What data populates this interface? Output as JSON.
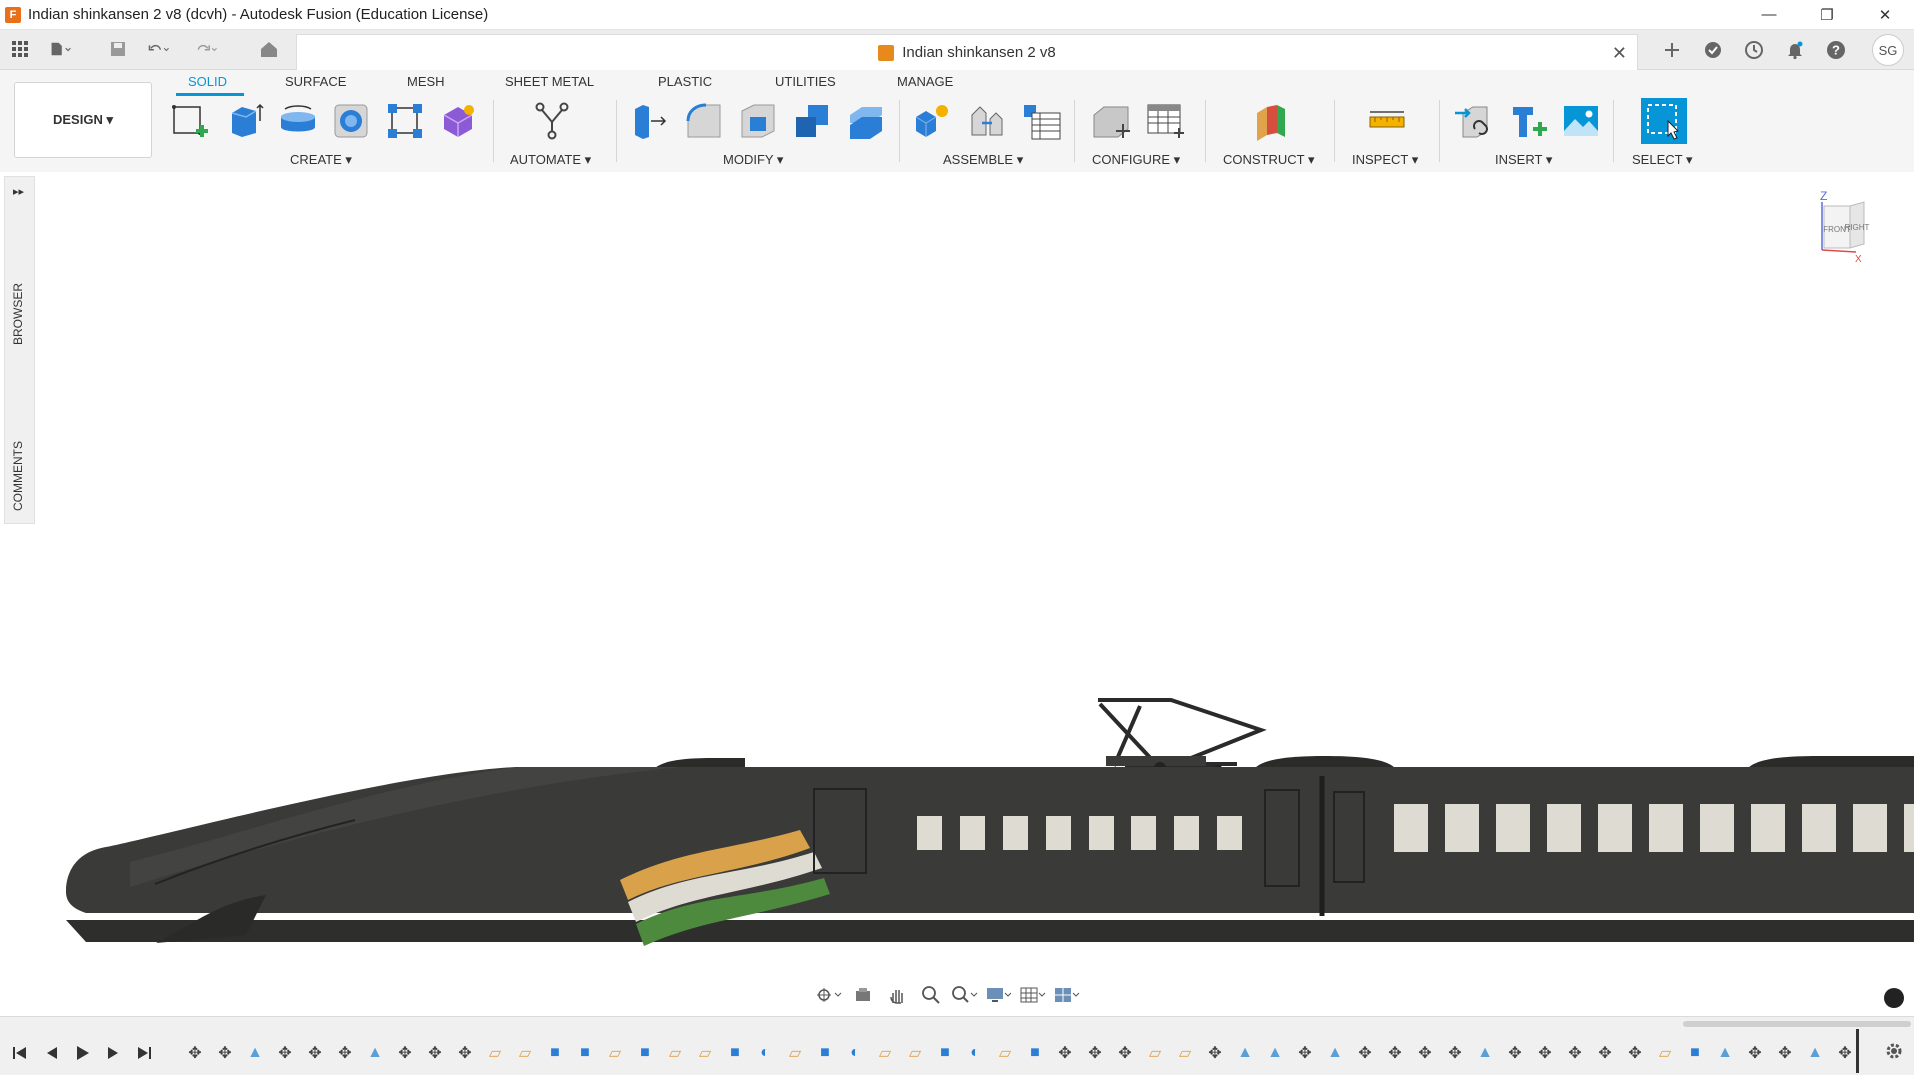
{
  "window": {
    "title": "Indian shinkansen 2 v8 (dcvh) - Autodesk Fusion (Education License)",
    "app_icon": "F",
    "controls": [
      "—",
      "❐",
      "✕"
    ]
  },
  "doc_tab": {
    "name": "Indian shinkansen 2 v8",
    "close": "✕"
  },
  "user": {
    "initials": "SG"
  },
  "workspace": {
    "label": "DESIGN ▾"
  },
  "tabs": [
    "SOLID",
    "SURFACE",
    "MESH",
    "SHEET METAL",
    "PLASTIC",
    "UTILITIES",
    "MANAGE"
  ],
  "groups": {
    "create": "CREATE ▾",
    "automate": "AUTOMATE ▾",
    "modify": "MODIFY ▾",
    "assemble": "ASSEMBLE ▾",
    "configure": "CONFIGURE ▾",
    "construct": "CONSTRUCT ▾",
    "inspect": "INSPECT ▾",
    "insert": "INSERT ▾",
    "select": "SELECT ▾"
  },
  "side": {
    "browser": "BROWSER",
    "comments": "COMMENTS",
    "expand": "▸▸"
  },
  "viewcube": {
    "front": "FRONT",
    "right": "RIGHT",
    "z": "Z",
    "x": "X"
  },
  "timeline": {
    "items": [
      "move",
      "move",
      "mirror",
      "move",
      "move",
      "move",
      "mirror",
      "move",
      "move",
      "move",
      "sketch",
      "sketch",
      "extrude",
      "extrude",
      "sketch",
      "extrude",
      "sketch",
      "sketch",
      "extrude",
      "revolve",
      "sketch",
      "extrude",
      "revolve",
      "sketch",
      "sketch",
      "extrude",
      "revolve",
      "sketch",
      "extrude",
      "move",
      "move",
      "move",
      "sketch",
      "sketch",
      "move",
      "mirror",
      "mirror",
      "move",
      "mirror",
      "move",
      "move",
      "move",
      "move",
      "mirror",
      "move",
      "move",
      "move",
      "move",
      "move",
      "sketch",
      "extrude",
      "mirror",
      "move",
      "move",
      "mirror",
      "move"
    ]
  },
  "colors": {
    "accent": "#0696d7",
    "train_body": "#3a3a38",
    "stripe_saffron": "#d9a24a",
    "stripe_white": "#dedbd2",
    "stripe_green": "#4d8a3d"
  }
}
